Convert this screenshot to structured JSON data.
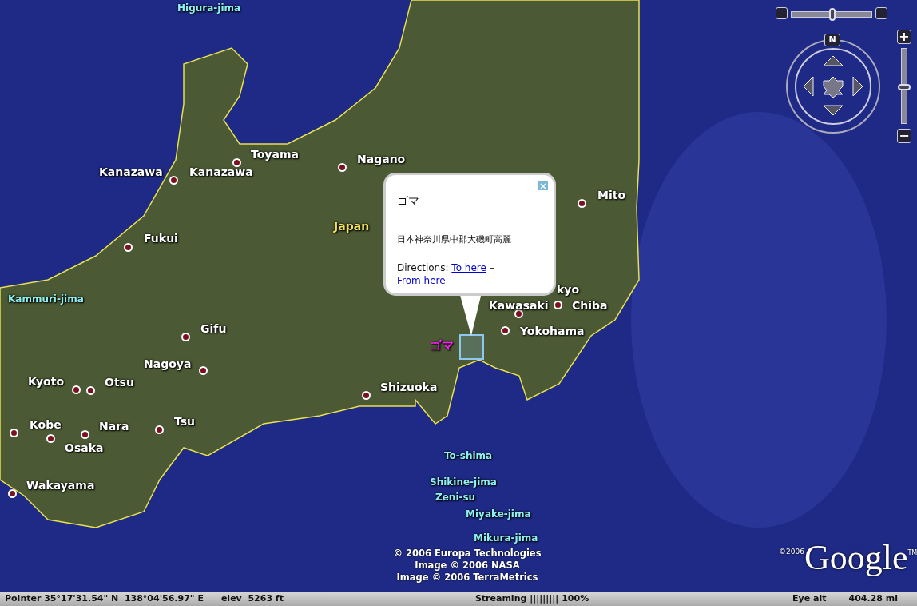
{
  "map_labels": [
    {
      "text": "Higura-jima",
      "kind": "island"
    },
    {
      "text": "Toyama",
      "kind": "city"
    },
    {
      "text": "Kanazawa",
      "kind": "label"
    },
    {
      "text": "Kanazawa",
      "kind": "city"
    },
    {
      "text": "Nagano",
      "kind": "city"
    },
    {
      "text": "Japan",
      "kind": "country"
    },
    {
      "text": "Mito",
      "kind": "city"
    },
    {
      "text": "Fukui",
      "kind": "city"
    },
    {
      "text": "Kammuri-jima",
      "kind": "island"
    },
    {
      "text": "kyo",
      "kind": "label"
    },
    {
      "text": "Kawasaki",
      "kind": "city"
    },
    {
      "text": "Chiba",
      "kind": "city"
    },
    {
      "text": "Yokohama",
      "kind": "city"
    },
    {
      "text": "Gifu",
      "kind": "city"
    },
    {
      "text": "Nagoya",
      "kind": "city"
    },
    {
      "text": "Kyoto",
      "kind": "city"
    },
    {
      "text": "Otsu",
      "kind": "city"
    },
    {
      "text": "Shizuoka",
      "kind": "city"
    },
    {
      "text": "Kobe",
      "kind": "city"
    },
    {
      "text": "Nara",
      "kind": "city"
    },
    {
      "text": "Tsu",
      "kind": "city"
    },
    {
      "text": "Osaka",
      "kind": "city"
    },
    {
      "text": "Wakayama",
      "kind": "city"
    },
    {
      "text": "To-shima",
      "kind": "island"
    },
    {
      "text": "Shikine-jima",
      "kind": "island"
    },
    {
      "text": "Zeni-su",
      "kind": "island"
    },
    {
      "text": "Miyake-jima",
      "kind": "island"
    },
    {
      "text": "Mikura-jima",
      "kind": "island"
    }
  ],
  "placemark": {
    "label": "ゴマ"
  },
  "balloon": {
    "title": "ゴマ",
    "address": "日本神奈川県中郡大磯町高麗",
    "directions_label": "Directions:",
    "links": [
      "To here",
      "From here"
    ],
    "separator": "–"
  },
  "navigation": {
    "north": "N",
    "tilt": {
      "level": 0.5
    },
    "zoom": {
      "plus": "+",
      "minus": "−",
      "level": 0.5
    }
  },
  "credits": [
    "© 2006 Europa Technologies",
    "Image © 2006 NASA",
    "Image © 2006 TerraMetrics"
  ],
  "logo": {
    "copyright": "©2006",
    "name": "Google",
    "tm": "TM"
  },
  "status_bar": {
    "pointer": "Pointer 35°17'31.54\" N  138°04'56.97\" E",
    "elev": "elev  5263 ft",
    "streaming": "Streaming ||||||||| 100%",
    "eye_alt_label": "Eye alt",
    "eye_alt": "404.28 mi"
  }
}
